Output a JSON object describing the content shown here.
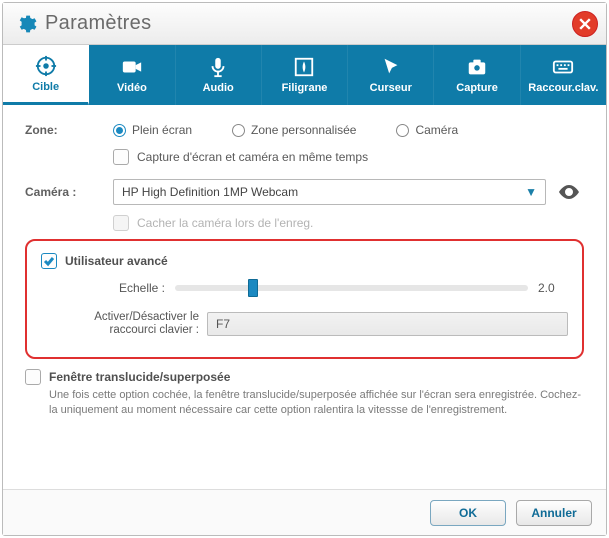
{
  "title": "Paramètres",
  "tabs": [
    {
      "label": "Cible"
    },
    {
      "label": "Vidéo"
    },
    {
      "label": "Audio"
    },
    {
      "label": "Filigrane"
    },
    {
      "label": "Curseur"
    },
    {
      "label": "Capture"
    },
    {
      "label": "Raccour.clav."
    }
  ],
  "zone": {
    "label": "Zone:",
    "options": [
      {
        "label": "Plein écran"
      },
      {
        "label": "Zone personnalisée"
      },
      {
        "label": "Caméra"
      }
    ],
    "dual_capture_label": "Capture d'écran et caméra en même temps"
  },
  "camera": {
    "label": "Caméra :",
    "selected": "HP High Definition 1MP Webcam",
    "hide_label": "Cacher la caméra lors de l'enreg."
  },
  "advanced": {
    "title": "Utilisateur avancé",
    "scale_label": "Echelle :",
    "scale_value": "2.0",
    "hotkey_label": "Activer/Désactiver le raccourci clavier :",
    "hotkey_value": "F7"
  },
  "translucent": {
    "title": "Fenêtre translucide/superposée",
    "desc": "Une fois cette option cochée, la fenêtre translucide/superposée affichée sur l'écran sera enregistrée. Cochez-la uniquement au moment nécessaire car cette option ralentira la vitessse de l'enregistrement."
  },
  "buttons": {
    "ok": "OK",
    "cancel": "Annuler"
  }
}
